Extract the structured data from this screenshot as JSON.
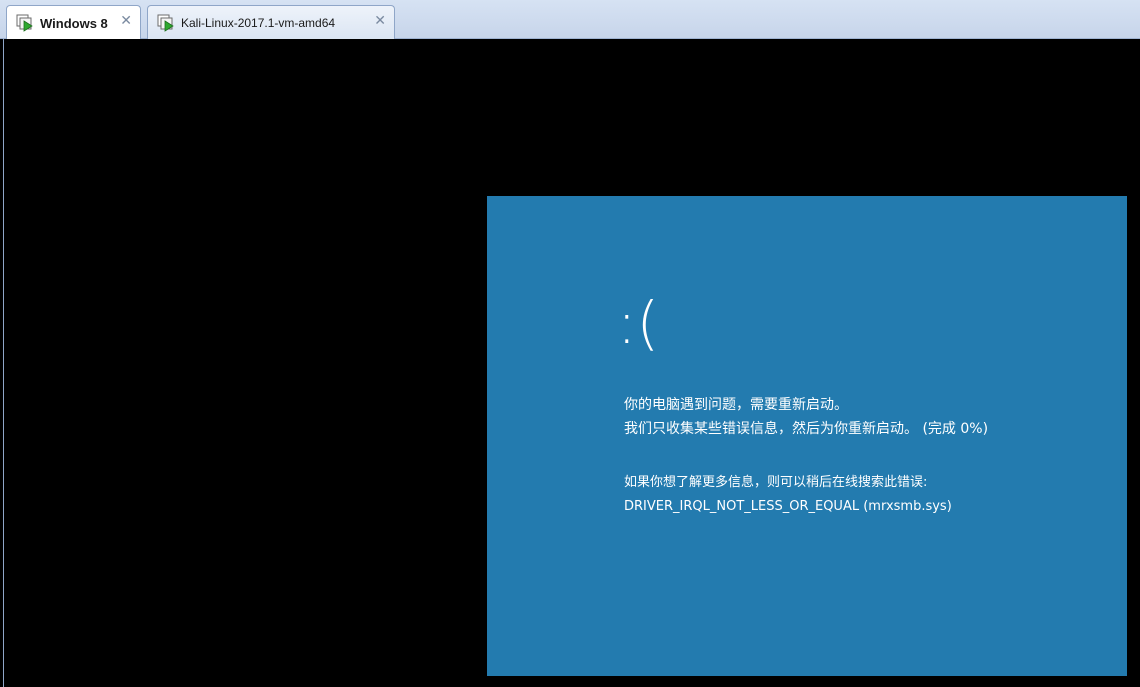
{
  "tabs": [
    {
      "label": "Windows 8",
      "active": true,
      "icon": "vm-running-icon",
      "close_glyph": "✕"
    },
    {
      "label": "Kali-Linux-2017.1-vm-amd64",
      "active": false,
      "icon": "vm-running-icon",
      "close_glyph": "✕"
    }
  ],
  "bsod": {
    "sad_face": ":(",
    "line1": "你的电脑遇到问题，需要重新启动。",
    "line2": "我们只收集某些错误信息，然后为你重新启动。 (完成 0%)",
    "line3": "如果你想了解更多信息，则可以稍后在线搜索此错误:",
    "line4": "DRIVER_IRQL_NOT_LESS_OR_EQUAL (mrxsmb.sys)",
    "progress_percent": 0,
    "background_color": "#237baf"
  }
}
